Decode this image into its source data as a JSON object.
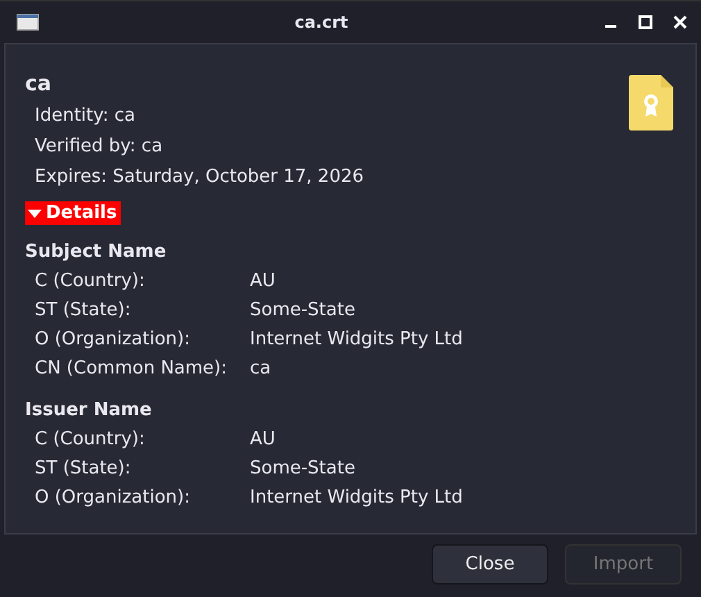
{
  "window": {
    "title": "ca.crt"
  },
  "certificate": {
    "name": "ca",
    "lines": [
      "Identity: ca",
      "Verified by: ca",
      "Expires: Saturday, October 17, 2026"
    ]
  },
  "details": {
    "label": "Details",
    "expanded": true,
    "sections": [
      {
        "title": "Subject Name",
        "fields": [
          {
            "label": "C (Country):",
            "value": "AU"
          },
          {
            "label": "ST (State):",
            "value": "Some-State"
          },
          {
            "label": "O (Organization):",
            "value": "Internet Widgits Pty Ltd"
          },
          {
            "label": "CN (Common Name):",
            "value": "ca"
          }
        ]
      },
      {
        "title": "Issuer Name",
        "fields": [
          {
            "label": "C (Country):",
            "value": "AU"
          },
          {
            "label": "ST (State):",
            "value": "Some-State"
          },
          {
            "label": "O (Organization):",
            "value": "Internet Widgits Pty Ltd"
          }
        ]
      }
    ]
  },
  "buttons": [
    {
      "label": "Close",
      "disabled": false
    },
    {
      "label": "Import",
      "disabled": true
    }
  ]
}
